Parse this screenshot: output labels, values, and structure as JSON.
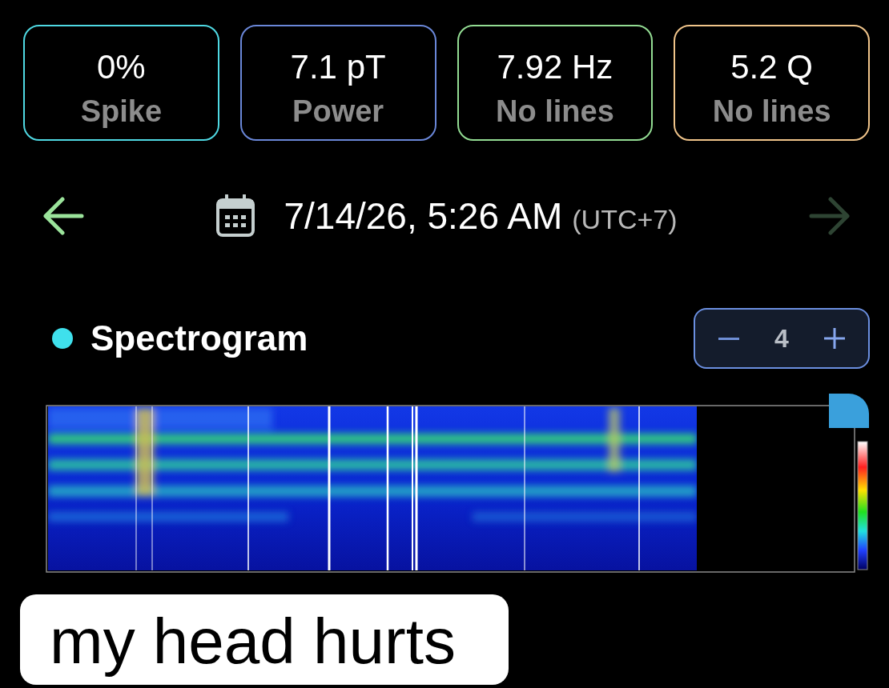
{
  "cards": [
    {
      "value": "0%",
      "label": "Spike",
      "color": "#4fd9e3"
    },
    {
      "value": "7.1 pT",
      "label": "Power",
      "color": "#6a87d8"
    },
    {
      "value": "7.92 Hz",
      "label": "No lines",
      "color": "#93dc93"
    },
    {
      "value": "5.2 Q",
      "label": "No lines",
      "color": "#f0c48a"
    }
  ],
  "date_nav": {
    "back": {
      "disabled": false
    },
    "date": "7/14/26, 5:26 AM",
    "timezone": "(UTC+7)",
    "forward": {
      "disabled": true
    }
  },
  "spectrogram": {
    "title": "Spectrogram",
    "stepper": {
      "value": "4"
    }
  },
  "caption": {
    "text": "my head hurts"
  }
}
